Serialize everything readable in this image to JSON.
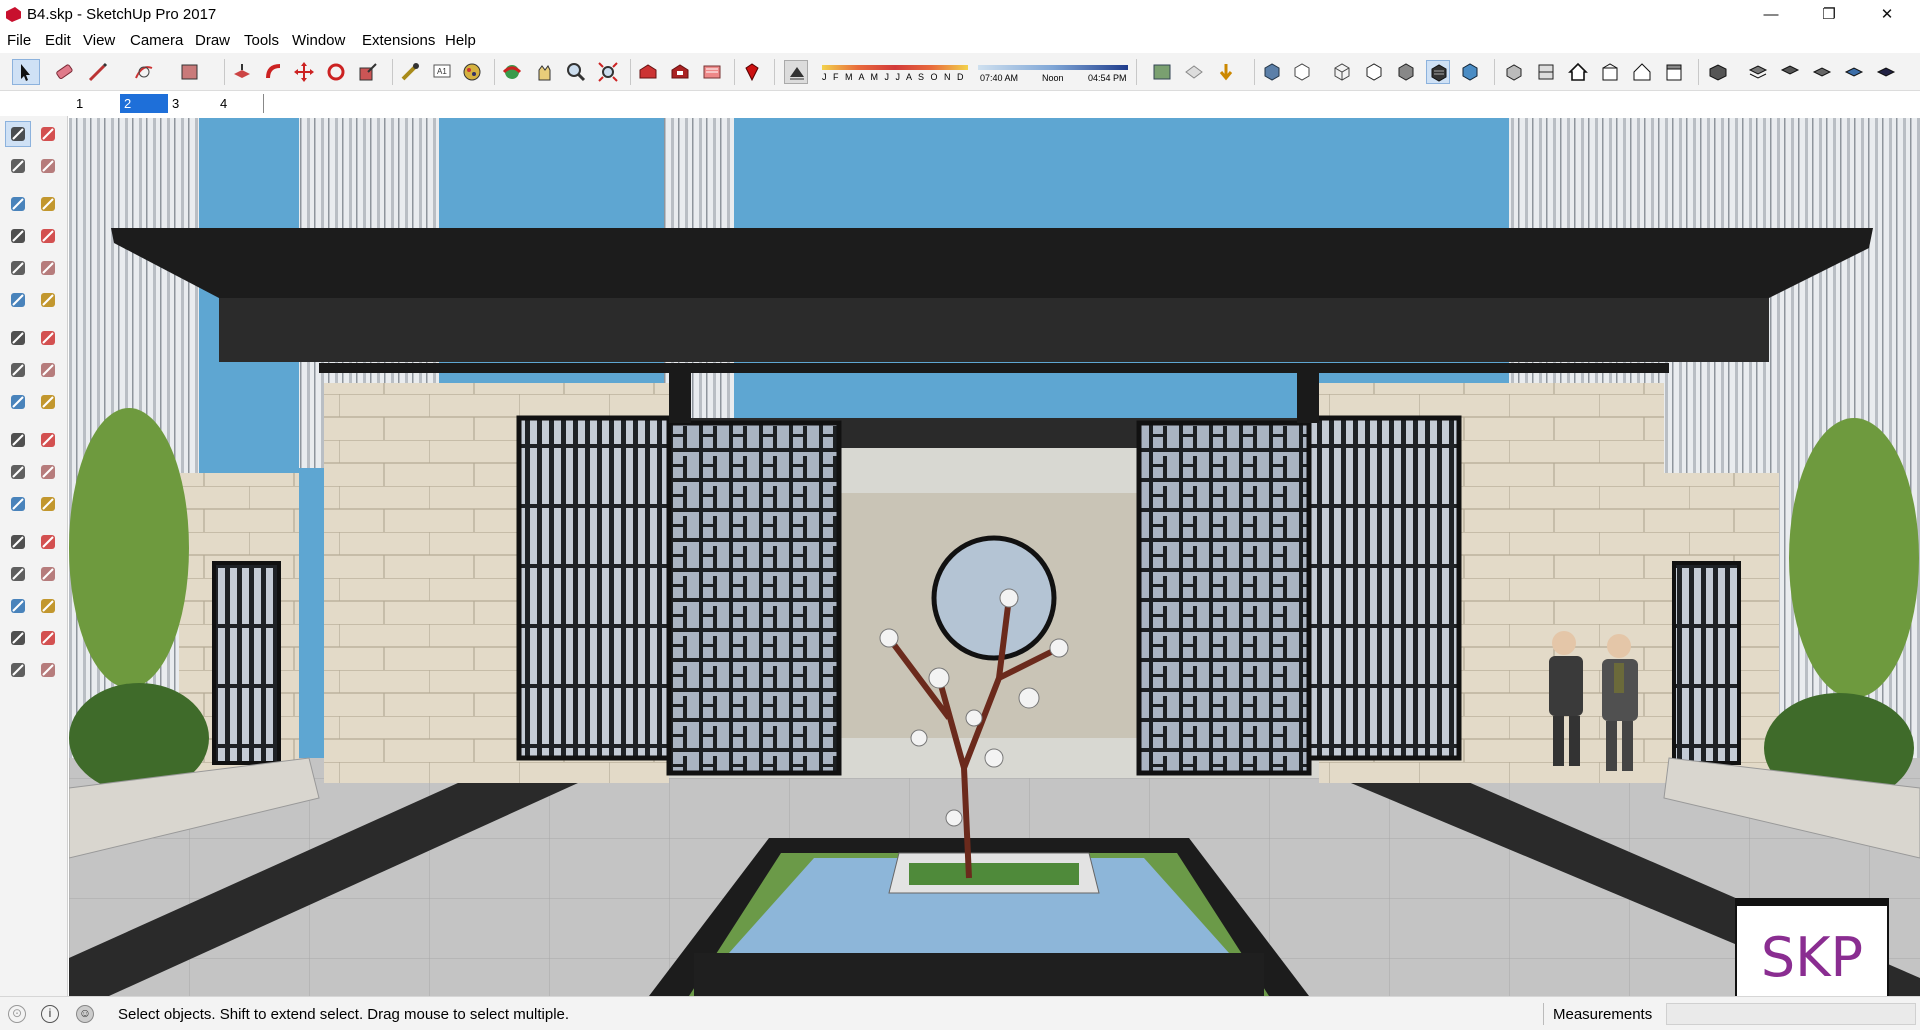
{
  "window": {
    "title": "B4.skp - SketchUp Pro 2017",
    "minimize_glyph": "—",
    "maximize_glyph": "❐",
    "close_glyph": "✕"
  },
  "menu": {
    "items": [
      "File",
      "Edit",
      "View",
      "Camera",
      "Draw",
      "Tools",
      "Window",
      "Extensions",
      "Help"
    ]
  },
  "shadows": {
    "months": "J F M A M J J A S O N D",
    "time_start": "07:40 AM",
    "time_mid": "Noon",
    "time_end": "04:54 PM"
  },
  "scenes": {
    "tabs": [
      "1",
      "2",
      "3",
      "4"
    ],
    "active": "2"
  },
  "status": {
    "message": "Select objects. Shift to extend select. Drag mouse to select multiple.",
    "measurements_label": "Measurements",
    "measurements_value": ""
  },
  "badge": {
    "text": "SKP"
  },
  "icons": {
    "toolbar": [
      "select-icon",
      "eraser-icon",
      "pencil-icon",
      "paint-icon",
      "rectangle-icon",
      "push-pull-icon",
      "follow-me-icon",
      "move-icon",
      "rotate-icon",
      "scale-icon",
      "tape-measure-icon",
      "text-icon",
      "paint-bucket-icon",
      "orbit-icon",
      "pan-icon",
      "zoom-icon",
      "zoom-extents-icon",
      "warehouse-icon",
      "extension-warehouse-icon",
      "layout-icon",
      "ruby-icon",
      "shadow-toggle-icon",
      "fog-icon",
      "section-icon",
      "standard-views-icon"
    ],
    "left_palette": [
      "select-tool-icon",
      "component-icon",
      "paint-bucket-tool-icon",
      "eraser-tool-icon",
      "line-tool-icon",
      "freehand-tool-icon",
      "rectangle-tool-icon",
      "rotated-rectangle-tool-icon",
      "circle-tool-icon",
      "polygon-tool-icon",
      "arc-tool-icon",
      "two-point-arc-tool-icon",
      "pie-tool-icon",
      "three-point-arc-tool-icon",
      "move-tool-icon",
      "push-pull-tool-icon",
      "rotate-tool-icon",
      "follow-me-tool-icon",
      "scale-tool-icon",
      "offset-tool-icon",
      "tape-tool-icon",
      "dimension-tool-icon",
      "protractor-tool-icon",
      "text-tool-icon",
      "axes-tool-icon",
      "3d-text-tool-icon",
      "orbit-tool-icon",
      "pan-tool-icon",
      "zoom-tool-icon",
      "zoom-window-tool-icon",
      "zoom-extents-tool-icon",
      "previous-view-tool-icon",
      "position-camera-tool-icon",
      "look-around-tool-icon",
      "walk-tool-icon",
      "section-plane-tool-icon"
    ]
  },
  "colors": {
    "sky": "#5ea6d2",
    "canopy": "#1c1c1c",
    "stone": "#e2d9c6",
    "screen": "#202428",
    "water": "#8db6d9",
    "pavement": "#b8b8b8",
    "accent": "#1e6fd9",
    "badge_text": "#8a2d91"
  }
}
